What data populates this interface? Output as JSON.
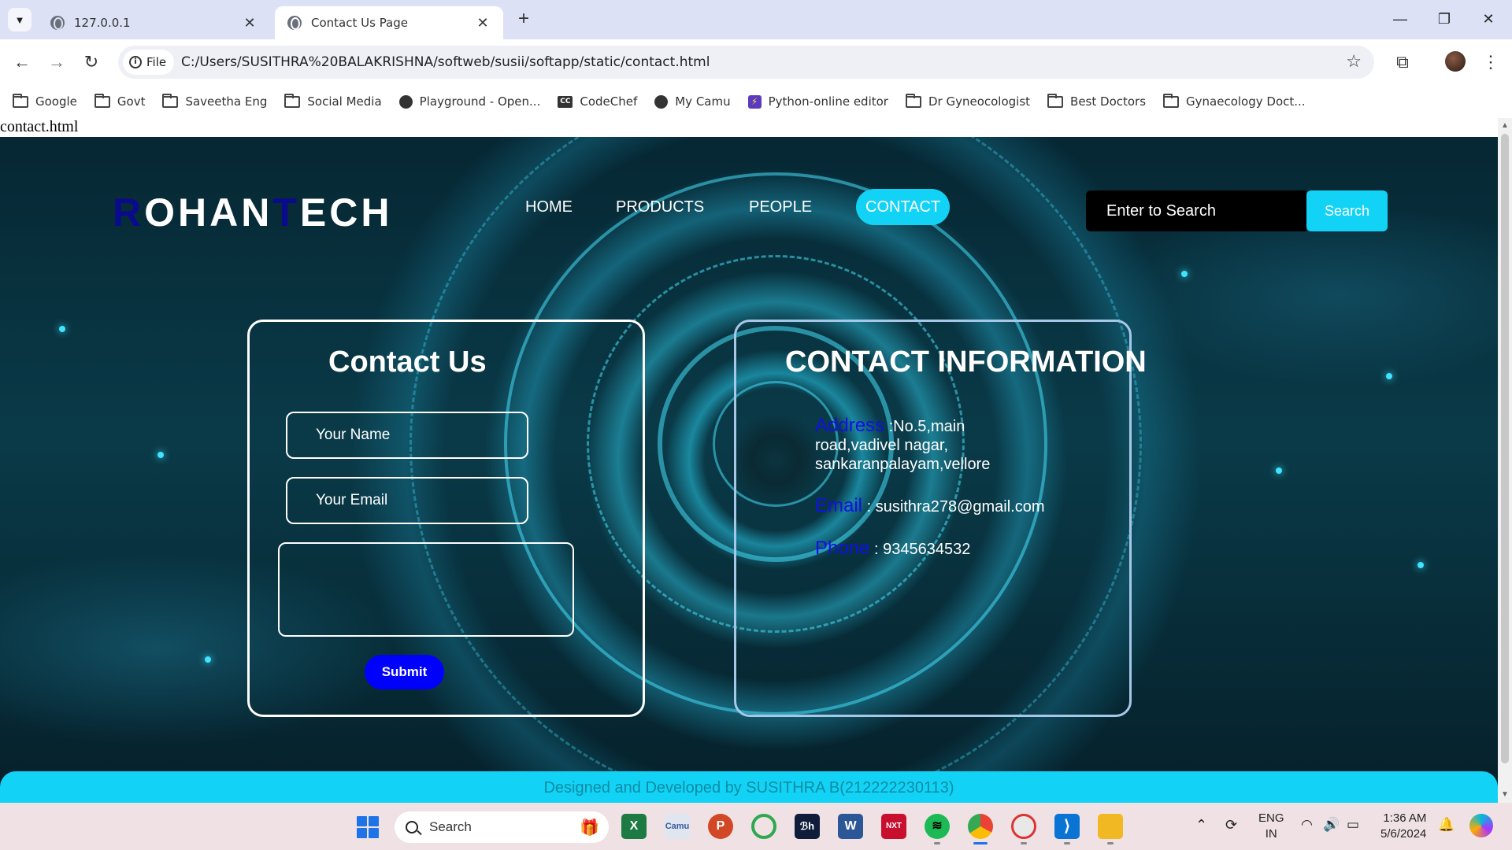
{
  "browser": {
    "tabs": [
      {
        "label": "127.0.0.1",
        "active": false
      },
      {
        "label": "Contact Us Page",
        "active": true
      }
    ],
    "address_chip": "File",
    "url": "C:/Users/SUSITHRA%20BALAKRISHNA/softweb/susii/softapp/static/contact.html",
    "bookmarks": [
      {
        "label": "Google",
        "icon": "folder-icon"
      },
      {
        "label": "Govt",
        "icon": "folder-icon"
      },
      {
        "label": "Saveetha Eng",
        "icon": "folder-icon"
      },
      {
        "label": "Social Media",
        "icon": "folder-icon"
      },
      {
        "label": "Playground - Open...",
        "icon": "openai-icon"
      },
      {
        "label": "CodeChef",
        "icon": "codechef-icon"
      },
      {
        "label": "My Camu",
        "icon": "globe-icon"
      },
      {
        "label": "Python-online editor",
        "icon": "python-editor-icon"
      },
      {
        "label": "Dr Gyneocologist",
        "icon": "folder-icon"
      },
      {
        "label": "Best Doctors",
        "icon": "folder-icon"
      },
      {
        "label": "Gynaecology Doct...",
        "icon": "folder-icon"
      }
    ]
  },
  "page": {
    "filename": "contact.html",
    "logo": {
      "first_initial": "R",
      "first_rest": "OHAN",
      "second_initial": "T",
      "second_rest": "ECH"
    },
    "nav": [
      "HOME",
      "PRODUCTS",
      "PEOPLE",
      "CONTACT"
    ],
    "active_nav": "CONTACT",
    "search": {
      "placeholder": "Enter to Search",
      "button": "Search"
    },
    "contact_form": {
      "title": "Contact Us",
      "name_placeholder": "Your Name",
      "email_placeholder": "Your Email",
      "submit": "Submit"
    },
    "contact_info": {
      "title": "CONTACT INFORMATION",
      "address_label": "Address",
      "address_line1": ":No.5,main",
      "address_line2": "road,vadivel nagar,",
      "address_line3": "sankaranpalayam,vellore",
      "email_label": "Email",
      "email_value": ": susithra278@gmail.com",
      "phone_label": "Phone",
      "phone_value": ": 9345634532"
    },
    "footer": "Designed and Developed by SUSITHRA B(212222230113)"
  },
  "taskbar": {
    "search": "Search",
    "language_line1": "ENG",
    "language_line2": "IN",
    "time": "1:36 AM",
    "date": "5/6/2024"
  },
  "colors": {
    "accent_cyan": "#12d3f5",
    "logo_accent": "#0a0a8c",
    "label_blue": "#1010e8",
    "submit_blue": "#0000ff"
  }
}
